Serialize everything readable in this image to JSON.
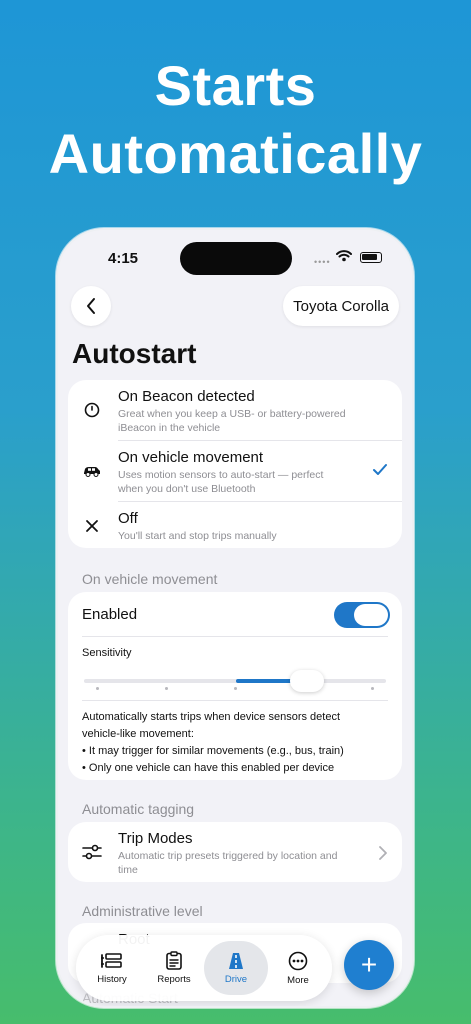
{
  "promo": {
    "line1": "Starts",
    "line2": "Automatically"
  },
  "status_bar": {
    "time": "4:15",
    "signal": "••••"
  },
  "nav": {
    "vehicle": "Toyota Corolla"
  },
  "page": {
    "title": "Autostart"
  },
  "options": [
    {
      "label": "On Beacon detected",
      "desc": "Great when you keep a USB- or battery-powered iBeacon in the vehicle",
      "icon": "beacon-icon",
      "selected": false
    },
    {
      "label": "On vehicle movement",
      "desc": "Uses motion sensors to auto-start — perfect when you don't use Bluetooth",
      "icon": "car-icon",
      "selected": true
    },
    {
      "label": "Off",
      "desc": "You'll start and stop trips manually",
      "icon": "close-icon",
      "selected": false
    }
  ],
  "movement": {
    "header": "On vehicle movement",
    "enabled_label": "Enabled",
    "enabled": true,
    "sensitivity_label": "Sensitivity",
    "sensitivity_level": 0.62,
    "info_line1": "Automatically starts trips when device sensors detect vehicle-like movement:",
    "bullet1": "• It may trigger for similar movements (e.g., bus, train)",
    "bullet2": "• Only one vehicle can have this enabled per device"
  },
  "tagging": {
    "header": "Automatic tagging",
    "label": "Trip Modes",
    "desc": "Automatic trip presets triggered by location and time"
  },
  "admin": {
    "header": "Administrative level",
    "partial_row": "Root"
  },
  "hidden_header": "Automatic Start",
  "tabbar": {
    "tabs": [
      {
        "label": "History",
        "icon": "history-icon"
      },
      {
        "label": "Reports",
        "icon": "reports-icon"
      },
      {
        "label": "Drive",
        "icon": "road-icon",
        "active": true
      },
      {
        "label": "More",
        "icon": "more-icon"
      }
    ],
    "fab_symbol": "+"
  },
  "colors": {
    "accent": "#1f77c8",
    "bg_top": "#1e96d6",
    "bg_bottom": "#47bd6c"
  }
}
